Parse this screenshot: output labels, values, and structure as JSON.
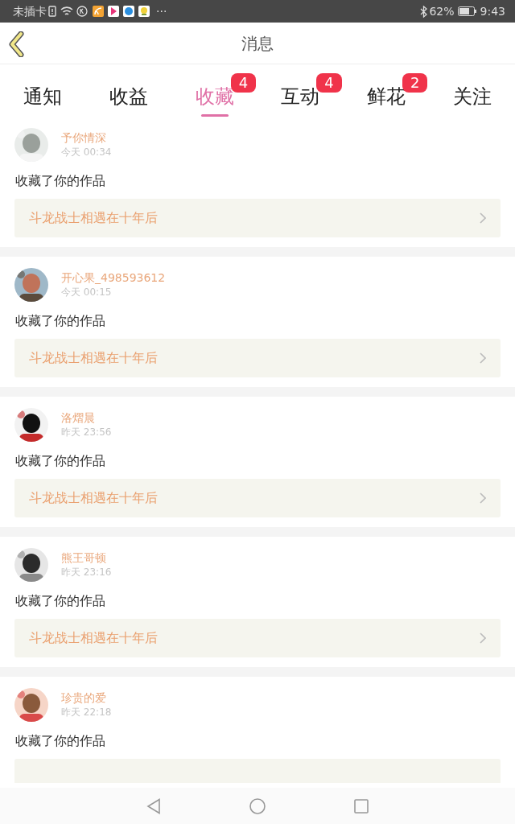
{
  "status_bar": {
    "carrier": "未插卡",
    "more": "···",
    "battery": "62%",
    "time": "9:43"
  },
  "header": {
    "title": "消息"
  },
  "tabs": [
    {
      "label": "通知",
      "selected": false
    },
    {
      "label": "收益",
      "selected": false
    },
    {
      "label": "收藏",
      "selected": true,
      "badge": "4"
    },
    {
      "label": "互动",
      "selected": false,
      "badge": "4"
    },
    {
      "label": "鲜花",
      "selected": false,
      "badge": "2"
    },
    {
      "label": "关注",
      "selected": false
    }
  ],
  "messages": [
    {
      "user": "予你情深",
      "time": "今天 00:34",
      "action": "收藏了你的作品",
      "work": "斗龙战士相遇在十年后"
    },
    {
      "user": "开心果_498593612",
      "time": "今天 00:15",
      "action": "收藏了你的作品",
      "work": "斗龙战士相遇在十年后"
    },
    {
      "user": "洛熠晨",
      "time": "昨天 23:56",
      "action": "收藏了你的作品",
      "work": "斗龙战士相遇在十年后"
    },
    {
      "user": "熊王哥顿",
      "time": "昨天 23:16",
      "action": "收藏了你的作品",
      "work": "斗龙战士相遇在十年后"
    },
    {
      "user": "珍贵的爱",
      "time": "昨天 22:18",
      "action": "收藏了你的作品"
    }
  ]
}
